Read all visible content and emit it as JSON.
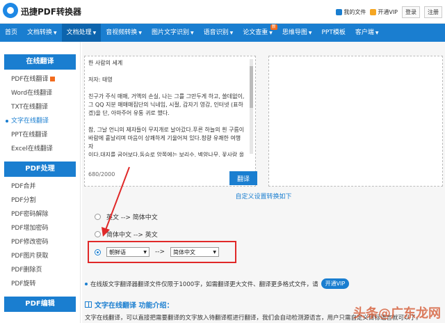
{
  "app": {
    "title": "迅捷PDF转换器"
  },
  "top_right": {
    "my_files": "我的文件",
    "vip": "开通VIP",
    "login": "登录",
    "register": "注册"
  },
  "nav": {
    "items": [
      {
        "label": "首页",
        "caret": false
      },
      {
        "label": "文档转换",
        "caret": true
      },
      {
        "label": "文档处理",
        "caret": true,
        "active": true
      },
      {
        "label": "音视频转换",
        "caret": true
      },
      {
        "label": "图片文字识别",
        "caret": true
      },
      {
        "label": "语音识别",
        "caret": true
      },
      {
        "label": "论文查重",
        "caret": true,
        "badge": "新"
      },
      {
        "label": "思维导图",
        "caret": true
      },
      {
        "label": "PPT模板",
        "caret": false
      },
      {
        "label": "客户端",
        "caret": true
      }
    ]
  },
  "sidebar": {
    "section1": "在线翻译",
    "items1": [
      "PDF在线翻译",
      "Word在线翻译",
      "TXT在线翻译",
      "文字在线翻译",
      "PPT在线翻译",
      "Excel在线翻译"
    ],
    "section2": "PDF处理",
    "items2": [
      "PDF合并",
      "PDF分割",
      "PDF密码解除",
      "PDF增加密码",
      "PDF修改密码",
      "PDF图片获取",
      "PDF删除页",
      "PDF旋转"
    ],
    "section3": "PDF编辑"
  },
  "source": {
    "text": "한 사람의 세계\n\n저자: 태영\n\n친구가 주식 매매, 거액의 손실, 나는 그를 그만두게 하고, 쓸데없이,\n그 QQ 지분 매매매집단의 닉네임, 시절, 갑자기 영감, 인터넷 (표하\n겠)을 단, 아마주어 유통 귀로 했다.\n\n참, 그날 언니의 제자들이 무지개로 날아갔다.푸른 하늘의 흰 구름이\n바람에 흩날리며 마음이 상쾌하게 기울어져 있다.청량 유쾌한 여행자\n이다.대지를 굽어보다.동승로 앙쪽에는 보리수, 벽양나무, 꽃사랑 올\n리브, 레몬자 등이 있다.나는 아이의 마음을 가진 연행을 보았다.성금\n성큼성큼 용진한다.뭐 공부 해요?그는 녹대를 잡고 있다.이 녹대는 귀\n엽고 귀여운 거지고 대재를 여고 있는 표현이 필요용을 보고 풀로 된",
    "counter": "680/2000",
    "translate_button": "翻译"
  },
  "custom": {
    "title": "自定义设置转换如下",
    "options": [
      "英文 --> 简体中文",
      "简体中文 --> 英文"
    ],
    "custom_arrow": "-->",
    "from_lang": "朝鲜语",
    "to_lang": "简体中文"
  },
  "note": {
    "text": "在线版文字翻译器翻译文件仅限于1000字，如需翻译更大文件、翻译更多格式文件，请",
    "vip_button": "开通VIP"
  },
  "intro": {
    "title": "文字在线翻译 功能介绍：",
    "text": "文字在线翻译，可以直接把需要翻译的文字放入待翻译框进行翻译，我们会自动检测源语言，用户只需自定义目标语言就可以了。"
  },
  "watermark": "头条@广东龙网"
}
